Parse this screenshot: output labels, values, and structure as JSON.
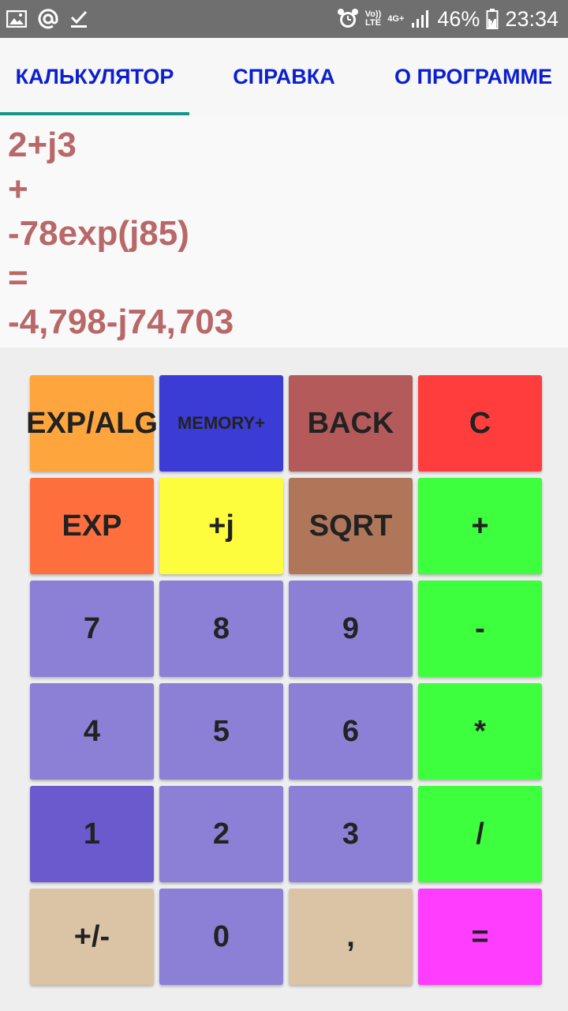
{
  "status_bar": {
    "icons_left": [
      "image-icon",
      "at-sign-icon",
      "checkmark-icon"
    ],
    "alarm_icon": "alarm-icon",
    "volte_top": "Vo))",
    "volte_bottom": "LTE",
    "network": "4G+",
    "signal_icon": "signal-icon",
    "battery_percent": "46%",
    "battery_icon": "battery-icon",
    "time": "23:34"
  },
  "tabs": [
    {
      "label": "КАЛЬКУЛЯТОР",
      "active": true
    },
    {
      "label": "СПРАВКА",
      "active": false
    },
    {
      "label": "О ПРОГРАММЕ",
      "active": false
    }
  ],
  "display": {
    "lines": [
      "2+j3",
      "+",
      "-78exp(j85)",
      "=",
      "-4,798-j74,703"
    ]
  },
  "colors": {
    "accent_tab": "#0b1fcf",
    "tab_indicator": "#16968a",
    "display_text": "#b86868"
  },
  "keys": [
    {
      "label": "EXP/ALG",
      "color": "#ffa53d"
    },
    {
      "label": "MEMORY+",
      "color": "#3b3bd6"
    },
    {
      "label": "BACK",
      "color": "#b55a5a"
    },
    {
      "label": "C",
      "color": "#ff3d3d"
    },
    {
      "label": "EXP",
      "color": "#ff6f3d"
    },
    {
      "label": "+j",
      "color": "#fdfd3d"
    },
    {
      "label": "SQRT",
      "color": "#b0765a"
    },
    {
      "label": "+",
      "color": "#3dff3d"
    },
    {
      "label": "7",
      "color": "#8b80d6"
    },
    {
      "label": "8",
      "color": "#8b80d6"
    },
    {
      "label": "9",
      "color": "#8b80d6"
    },
    {
      "label": "-",
      "color": "#3dff3d"
    },
    {
      "label": "4",
      "color": "#8b80d6"
    },
    {
      "label": "5",
      "color": "#8b80d6"
    },
    {
      "label": "6",
      "color": "#8b80d6"
    },
    {
      "label": "*",
      "color": "#3dff3d"
    },
    {
      "label": "1",
      "color": "#6a5acd"
    },
    {
      "label": "2",
      "color": "#8b80d6"
    },
    {
      "label": "3",
      "color": "#8b80d6"
    },
    {
      "label": "/",
      "color": "#3dff3d"
    },
    {
      "label": "+/-",
      "color": "#dbc3a5"
    },
    {
      "label": "0",
      "color": "#8b80d6"
    },
    {
      "label": ",",
      "color": "#dbc3a5"
    },
    {
      "label": "=",
      "color": "#ff3dff"
    }
  ]
}
